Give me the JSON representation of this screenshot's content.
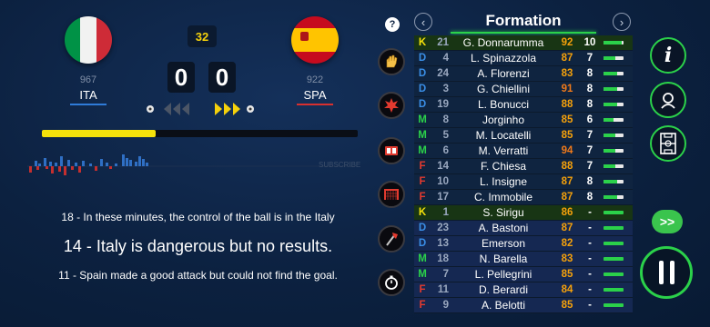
{
  "match": {
    "minute": "32",
    "home": {
      "code": "ITA",
      "rating": "967",
      "score": "0",
      "underline": "#2f7bd8"
    },
    "away": {
      "code": "SPA",
      "rating": "922",
      "score": "0",
      "underline": "#d8302f"
    },
    "possession_progress": 0.36
  },
  "commentary": [
    "18 - In these minutes, the control of the ball is in the Italy",
    "14 - Italy is dangerous but no results.",
    "11 - Spain made a good attack but could not find the goal."
  ],
  "watermark": "SUBSCRIBE",
  "help_label": "?",
  "formation": {
    "title": "Formation",
    "prev_label": "‹",
    "next_label": "›"
  },
  "position_colors": {
    "K": "#f5e20b",
    "D": "#3a8ee6",
    "M": "#2bd14a",
    "F": "#e23a2f"
  },
  "players": [
    {
      "pos": "K",
      "num": "21",
      "name": "G. Donnarumma",
      "rating": "92",
      "rating_color": "#f5a10b",
      "stam": "10",
      "cond": 0.9,
      "type": "highlight"
    },
    {
      "pos": "D",
      "num": "4",
      "name": "L. Spinazzola",
      "rating": "87",
      "rating_color": "#f5a10b",
      "stam": "7",
      "cond": 0.6,
      "type": "starter"
    },
    {
      "pos": "D",
      "num": "24",
      "name": "A. Florenzi",
      "rating": "83",
      "rating_color": "#f5a10b",
      "stam": "8",
      "cond": 0.7,
      "type": "starter"
    },
    {
      "pos": "D",
      "num": "3",
      "name": "G. Chiellini",
      "rating": "91",
      "rating_color": "#f07a1a",
      "stam": "8",
      "cond": 0.7,
      "type": "starter"
    },
    {
      "pos": "D",
      "num": "19",
      "name": "L. Bonucci",
      "rating": "88",
      "rating_color": "#f5a10b",
      "stam": "8",
      "cond": 0.7,
      "type": "starter"
    },
    {
      "pos": "M",
      "num": "8",
      "name": "Jorginho",
      "rating": "85",
      "rating_color": "#f5a10b",
      "stam": "6",
      "cond": 0.5,
      "type": "starter"
    },
    {
      "pos": "M",
      "num": "5",
      "name": "M. Locatelli",
      "rating": "85",
      "rating_color": "#f5a10b",
      "stam": "7",
      "cond": 0.6,
      "type": "starter"
    },
    {
      "pos": "M",
      "num": "6",
      "name": "M. Verratti",
      "rating": "94",
      "rating_color": "#f07a1a",
      "stam": "7",
      "cond": 0.6,
      "type": "starter"
    },
    {
      "pos": "F",
      "num": "14",
      "name": "F. Chiesa",
      "rating": "88",
      "rating_color": "#f5a10b",
      "stam": "7",
      "cond": 0.6,
      "type": "starter"
    },
    {
      "pos": "F",
      "num": "10",
      "name": "L. Insigne",
      "rating": "87",
      "rating_color": "#f5a10b",
      "stam": "8",
      "cond": 0.7,
      "type": "starter"
    },
    {
      "pos": "F",
      "num": "17",
      "name": "C. Immobile",
      "rating": "87",
      "rating_color": "#f5a10b",
      "stam": "8",
      "cond": 0.7,
      "type": "starter"
    },
    {
      "pos": "K",
      "num": "1",
      "name": "S. Sirigu",
      "rating": "86",
      "rating_color": "#f5a10b",
      "stam": "-",
      "cond": 1.0,
      "type": "highlight"
    },
    {
      "pos": "D",
      "num": "23",
      "name": "A. Bastoni",
      "rating": "87",
      "rating_color": "#f5a10b",
      "stam": "-",
      "cond": 1.0,
      "type": "sub"
    },
    {
      "pos": "D",
      "num": "13",
      "name": "Emerson",
      "rating": "82",
      "rating_color": "#f5a10b",
      "stam": "-",
      "cond": 1.0,
      "type": "sub"
    },
    {
      "pos": "M",
      "num": "18",
      "name": "N. Barella",
      "rating": "83",
      "rating_color": "#f5a10b",
      "stam": "-",
      "cond": 1.0,
      "type": "sub"
    },
    {
      "pos": "M",
      "num": "7",
      "name": "L. Pellegrini",
      "rating": "85",
      "rating_color": "#f5a10b",
      "stam": "-",
      "cond": 1.0,
      "type": "sub"
    },
    {
      "pos": "F",
      "num": "11",
      "name": "D. Berardi",
      "rating": "84",
      "rating_color": "#f5a10b",
      "stam": "-",
      "cond": 1.0,
      "type": "sub"
    },
    {
      "pos": "F",
      "num": "9",
      "name": "A. Belotti",
      "rating": "85",
      "rating_color": "#f5a10b",
      "stam": "-",
      "cond": 1.0,
      "type": "sub"
    }
  ],
  "controls": {
    "info_label": "i",
    "ff_label": ">>"
  },
  "icons": {
    "tactics": "glove-icon",
    "fouls": "whistle-icon",
    "substitution": "sub-board-icon",
    "goal": "goal-net-icon",
    "injury": "axe-icon",
    "timer": "stopwatch-icon",
    "coach": "coach-icon",
    "pitch": "pitch-icon"
  }
}
